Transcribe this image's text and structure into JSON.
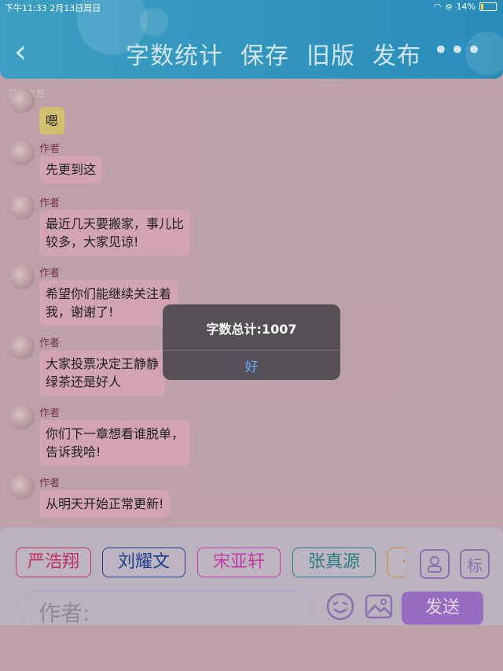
{
  "status_bar": {
    "time_date": "下午11:33  2月13日周日",
    "battery": "14%"
  },
  "toolbar": {
    "back": "‹",
    "actions": [
      "字数统计",
      "保存",
      "旧版",
      "发布"
    ],
    "more": "•••"
  },
  "chapter": "第十六章",
  "messages": [
    {
      "author": "",
      "text": "嗯"
    },
    {
      "author": "作者",
      "text": "先更到这"
    },
    {
      "author": "作者",
      "text": "最近几天要搬家，事儿比\n较多，大家见谅!"
    },
    {
      "author": "作者",
      "text": "希望你们能继续关注着\n我，谢谢了!"
    },
    {
      "author": "作者",
      "text": "大家投票决定王静静\n绿茶还是好人"
    },
    {
      "author": "作者",
      "text": "你们下一章想看谁脱单，\n告诉我哈!"
    },
    {
      "author": "作者",
      "text": "从明天开始正常更新!"
    }
  ],
  "characters": [
    {
      "name": "严浩翔",
      "color": "#c2345d"
    },
    {
      "name": "刘耀文",
      "color": "#1f3f8f"
    },
    {
      "name": "宋亚轩",
      "color": "#c83ca6"
    },
    {
      "name": "张真源",
      "color": "#2d7f86"
    },
    {
      "name": "·",
      "color": "#d88b2f"
    }
  ],
  "side_buttons": {
    "tag_label": "标"
  },
  "composer": {
    "placeholder": "作者:",
    "send_label": "发送"
  },
  "alert": {
    "title": "字数总计:1007",
    "ok": "好"
  }
}
